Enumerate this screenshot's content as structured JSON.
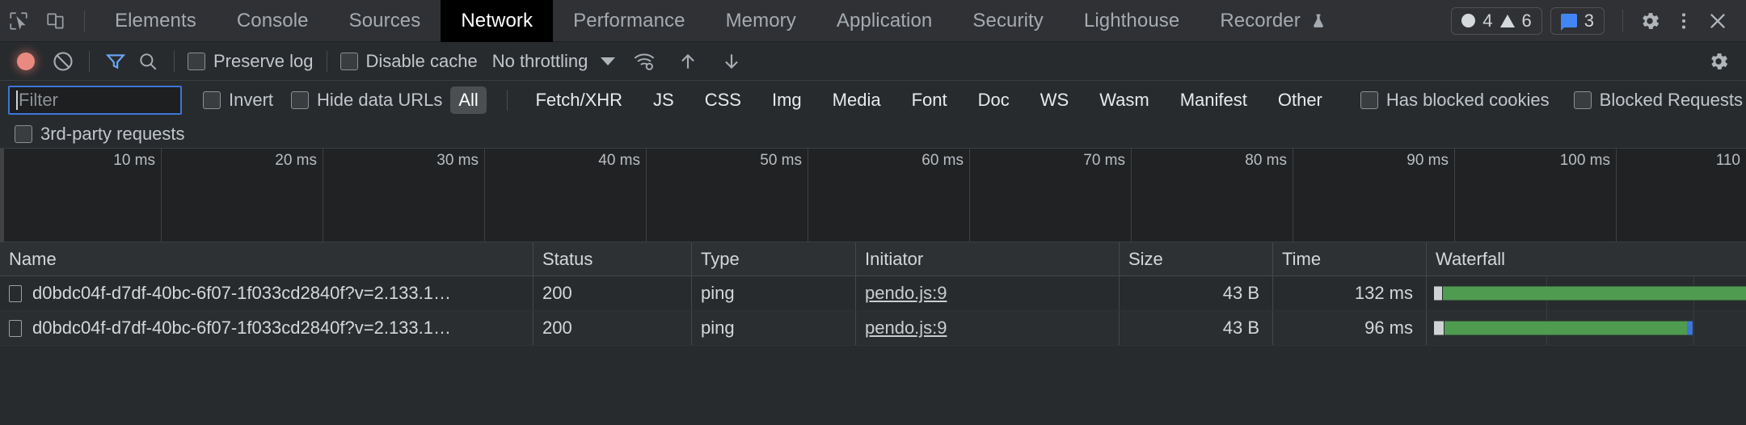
{
  "header": {
    "icons": [
      {
        "name": "inspect-element-icon",
        "label": "Inspect element"
      },
      {
        "name": "device-toolbar-icon",
        "label": "Toggle device toolbar"
      }
    ],
    "tabs": [
      {
        "label": "Elements",
        "active": false
      },
      {
        "label": "Console",
        "active": false
      },
      {
        "label": "Sources",
        "active": false
      },
      {
        "label": "Network",
        "active": true
      },
      {
        "label": "Performance",
        "active": false
      },
      {
        "label": "Memory",
        "active": false
      },
      {
        "label": "Application",
        "active": false
      },
      {
        "label": "Security",
        "active": false
      },
      {
        "label": "Lighthouse",
        "active": false
      },
      {
        "label": "Recorder",
        "active": false,
        "experimental": true
      }
    ],
    "counters": {
      "errors": "4",
      "warnings": "6",
      "messages": "3",
      "message_color": "#4285f4"
    },
    "settings_label": "Settings",
    "more_label": "Customize and control DevTools",
    "close_label": "Close DevTools"
  },
  "controls": {
    "record_label": "Stop recording network log",
    "clear_label": "Clear network log",
    "filter_label": "Filter",
    "search_label": "Search",
    "preserve_log": "Preserve log",
    "disable_cache": "Disable cache",
    "throttling": "No throttling",
    "network_conditions_label": "More network conditions",
    "import_label": "Import HAR file",
    "export_label": "Export HAR file",
    "settings_label": "Network settings"
  },
  "filters": {
    "input_value": "",
    "input_placeholder": "Filter",
    "invert": "Invert",
    "hide_data_urls": "Hide data URLs",
    "types": [
      {
        "label": "All",
        "selected": true
      },
      {
        "label": "Fetch/XHR",
        "selected": false
      },
      {
        "label": "JS",
        "selected": false
      },
      {
        "label": "CSS",
        "selected": false
      },
      {
        "label": "Img",
        "selected": false
      },
      {
        "label": "Media",
        "selected": false
      },
      {
        "label": "Font",
        "selected": false
      },
      {
        "label": "Doc",
        "selected": false
      },
      {
        "label": "WS",
        "selected": false
      },
      {
        "label": "Wasm",
        "selected": false
      },
      {
        "label": "Manifest",
        "selected": false
      },
      {
        "label": "Other",
        "selected": false
      }
    ],
    "has_blocked_cookies": "Has blocked cookies",
    "blocked_requests": "Blocked Requests",
    "third_party_requests": "3rd-party requests"
  },
  "overview": {
    "ticks": [
      "10 ms",
      "20 ms",
      "30 ms",
      "40 ms",
      "50 ms",
      "60 ms",
      "70 ms",
      "80 ms",
      "90 ms",
      "100 ms",
      "110"
    ]
  },
  "table": {
    "columns": [
      "Name",
      "Status",
      "Type",
      "Initiator",
      "Size",
      "Time",
      "Waterfall"
    ],
    "rows": [
      {
        "name": "d0bdc04f-d7df-40bc-6f07-1f033cd2840f?v=2.133.1…",
        "status": "200",
        "type": "ping",
        "initiator": "pendo.js:9",
        "size": "43 B",
        "time": "132 ms"
      },
      {
        "name": "d0bdc04f-d7df-40bc-6f07-1f033cd2840f?v=2.133.1…",
        "status": "200",
        "type": "ping",
        "initiator": "pendo.js:9",
        "size": "43 B",
        "time": "96 ms"
      }
    ]
  }
}
